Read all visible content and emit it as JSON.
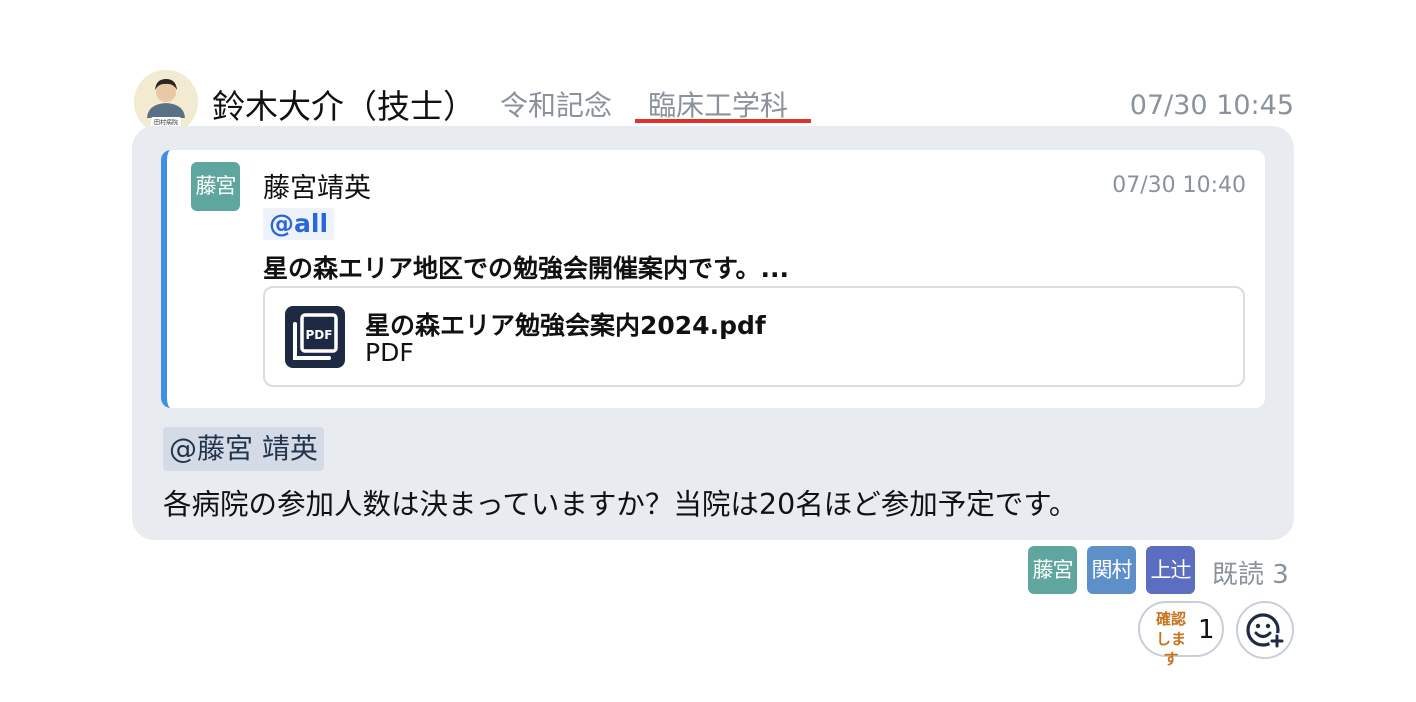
{
  "message": {
    "sender_name": "鈴木大介（技士）",
    "sender_org": "令和記念",
    "sender_dept": "臨床工学科",
    "time": "07/30 10:45",
    "avatar_caption": "田村病院",
    "mention": "@藤宮 靖英",
    "body": "各病院の参加人数は決まっていますか？当院は20名ほど参加予定です。"
  },
  "quoted": {
    "avatar_label": "藤宮",
    "name": "藤宮靖英",
    "time": "07/30 10:40",
    "mention": "@all",
    "text": "星の森エリア地区での勉強会開催案内です。...",
    "attachment": {
      "icon": "pdf-icon",
      "filename": "星の森エリア勉強会案内2024.pdf",
      "type": "PDF"
    }
  },
  "read_receipt": {
    "readers": [
      {
        "label": "藤宮",
        "color": "#5fa79e"
      },
      {
        "label": "関村",
        "color": "#5d8fc9"
      },
      {
        "label": "上辻",
        "color": "#5b6ec1"
      }
    ],
    "label": "既読 3"
  },
  "reactions": [
    {
      "stamp_line1": "確認",
      "stamp_line2": "します",
      "color": "#c8731e",
      "count": "1"
    }
  ],
  "add_reaction_icon": "add-emoji-icon",
  "colors": {
    "bubble": "#e8ecf1",
    "quote_accent": "#3f8fe3",
    "dept_underline": "#e0302a",
    "mention_all": "#2a66d6"
  }
}
